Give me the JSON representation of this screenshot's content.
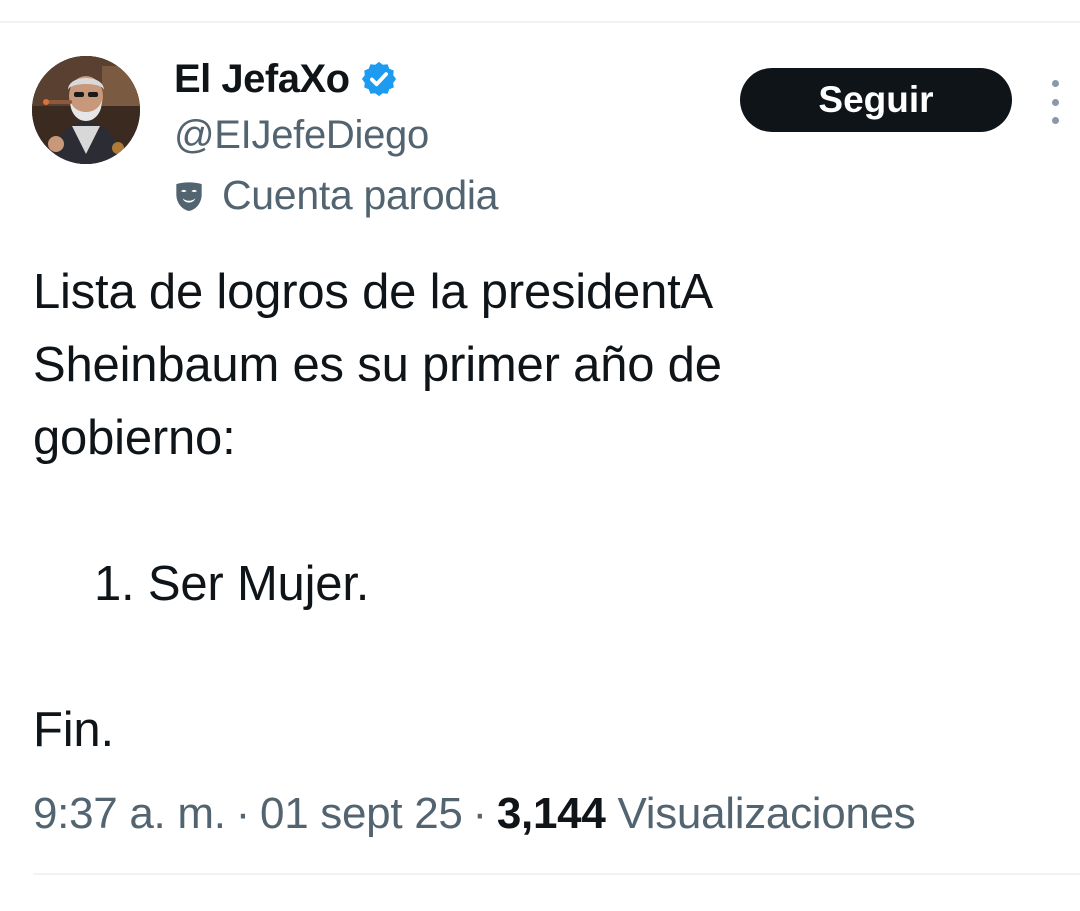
{
  "author": {
    "display_name": "El JefaXo",
    "handle": "@EIJefeDiego",
    "verified_icon": "verified-badge-icon",
    "parody_icon": "theater-mask-icon",
    "parody_label": "Cuenta parodia"
  },
  "actions": {
    "follow_label": "Seguir",
    "more_icon": "more-vertical-icon"
  },
  "tweet": {
    "lines": [
      "Lista de logros de la presidentA",
      "Sheinbaum es su primer año de",
      "gobierno:",
      "",
      "1. Ser Mujer.",
      "",
      "Fin."
    ]
  },
  "meta": {
    "time": "9:37 a. m.",
    "date": "01 sept 25",
    "separator": "·",
    "views_count": "3,144",
    "views_label": "Visualizaciones"
  },
  "colors": {
    "text_primary": "#0f1419",
    "text_secondary": "#536471",
    "verified_blue": "#1d9bf0",
    "button_bg": "#0f1419",
    "divider": "#eff3f4"
  }
}
